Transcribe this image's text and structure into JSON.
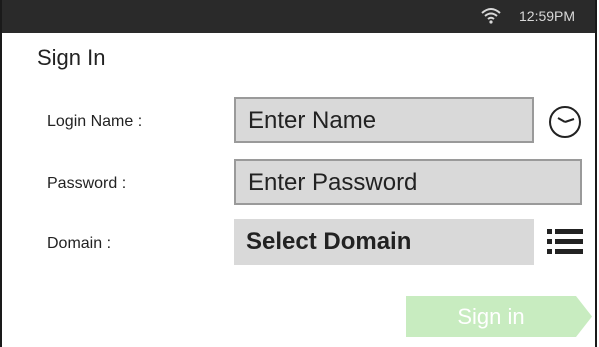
{
  "status_bar": {
    "time": "12:59PM",
    "wifi_icon": "wifi-icon"
  },
  "page": {
    "title": "Sign In"
  },
  "form": {
    "login": {
      "label": "Login Name :",
      "placeholder": "Enter Name",
      "icon": "clock-icon"
    },
    "password": {
      "label": "Password :",
      "placeholder": "Enter Password"
    },
    "domain": {
      "label": "Domain :",
      "selected": "Select Domain",
      "icon": "list-icon"
    }
  },
  "actions": {
    "sign_in_label": "Sign in",
    "sign_in_color": "#c8ecc0"
  },
  "colors": {
    "status_bar_bg": "#2a2a2a",
    "field_bg": "#d9d9d9"
  }
}
